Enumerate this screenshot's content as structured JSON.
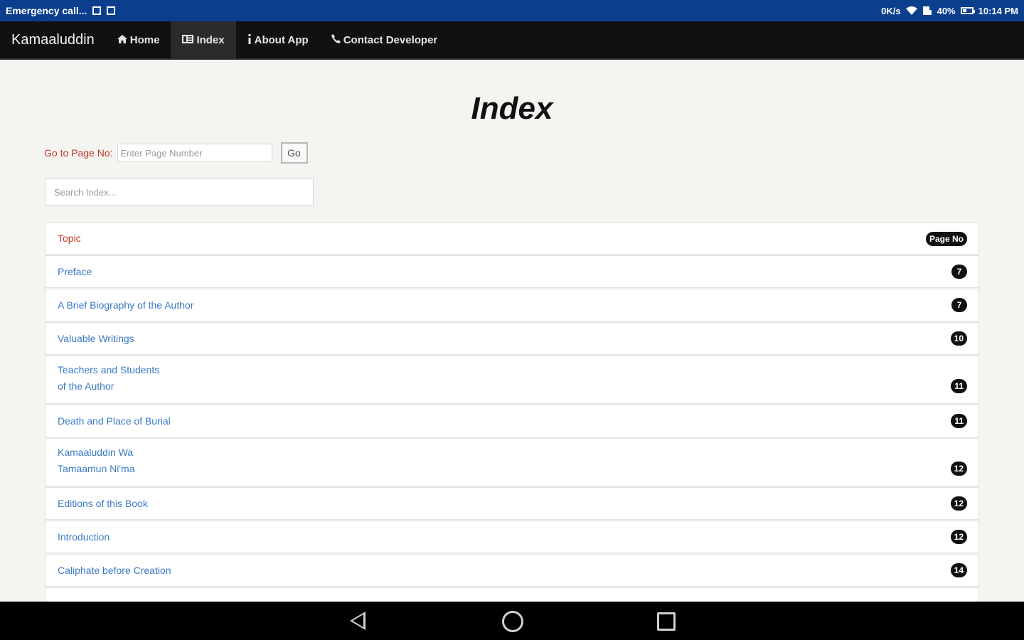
{
  "status_bar": {
    "carrier": "Emergency call...",
    "net_speed": "0K/s",
    "battery": "40%",
    "time": "10:14 PM"
  },
  "nav": {
    "brand": "Kamaaluddin",
    "items": [
      {
        "icon": "home-icon",
        "label": "Home"
      },
      {
        "icon": "list-icon",
        "label": "Index"
      },
      {
        "icon": "info-icon",
        "label": "About App"
      },
      {
        "icon": "phone-icon",
        "label": "Contact Developer"
      }
    ],
    "active": "Index"
  },
  "page": {
    "title": "Index",
    "goto_label": "Go to Page No:",
    "goto_placeholder": "Enter Page Number",
    "go_button": "Go",
    "search_placeholder": "Search Index..."
  },
  "list": {
    "header_topic": "Topic",
    "header_page": "Page No",
    "rows": [
      {
        "lines": [
          "Preface"
        ],
        "page": "7"
      },
      {
        "lines": [
          "A Brief Biography of the Author"
        ],
        "page": "7"
      },
      {
        "lines": [
          "Valuable Writings"
        ],
        "page": "10"
      },
      {
        "lines": [
          "Teachers and Students",
          "of the Author"
        ],
        "page": "11"
      },
      {
        "lines": [
          "Death and Place of Burial"
        ],
        "page": "11"
      },
      {
        "lines": [
          "Kamaaluddin Wa",
          "Tamaamun Ni'ma"
        ],
        "page": "12"
      },
      {
        "lines": [
          "Editions of this Book"
        ],
        "page": "12"
      },
      {
        "lines": [
          "Introduction"
        ],
        "page": "12"
      },
      {
        "lines": [
          "Caliphate before Creation"
        ],
        "page": "14"
      }
    ]
  },
  "colors": {
    "status_bar": "#0b3f8e",
    "navbar": "#111111",
    "link": "#3a7ac6",
    "accent_red": "#c0392b",
    "page_bg": "#f4f4f0"
  }
}
